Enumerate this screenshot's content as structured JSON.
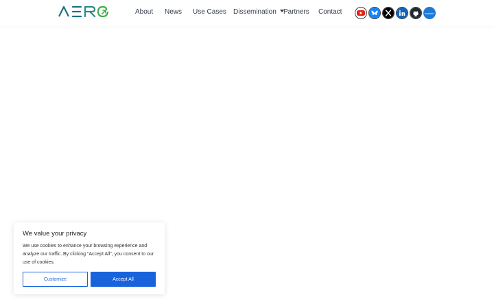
{
  "header": {
    "logo_text": "AERO",
    "nav": [
      {
        "label": "About"
      },
      {
        "label": "News"
      },
      {
        "label": "Use Cases"
      },
      {
        "label": "Dissemination"
      },
      {
        "label": "Partners"
      },
      {
        "label": "Contact"
      }
    ],
    "socials": [
      {
        "icon": "youtube-icon",
        "color": "#e62117"
      },
      {
        "icon": "bluesky-icon",
        "color": "#1185fe"
      },
      {
        "icon": "x-icon",
        "color": "#000000"
      },
      {
        "icon": "linkedin-icon",
        "color": "#0a66c2"
      },
      {
        "icon": "github-icon",
        "color": "#24292f"
      },
      {
        "icon": "zenodo-icon",
        "color": "#1f7ad6",
        "text": "zenodo"
      }
    ]
  },
  "cookie_banner": {
    "title": "We value your privacy",
    "text": "We use cookies to enhance your browsing experience and analyze our traffic. By clicking \"Accept All\", you consent to our use of cookies.",
    "customize_label": "Customize",
    "accept_label": "Accept All"
  },
  "colors": {
    "logo_primary": "#1b6f86",
    "logo_accent": "#3fae49",
    "accent_blue": "#1863dc"
  }
}
